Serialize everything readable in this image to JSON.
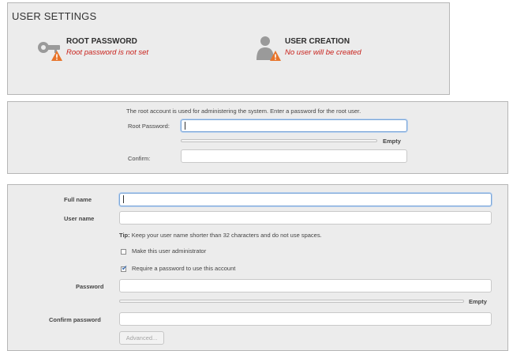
{
  "user_settings": {
    "title": "USER SETTINGS",
    "spokes": [
      {
        "title": "ROOT PASSWORD",
        "status": "Root password is not set",
        "icon": "key-warning-icon"
      },
      {
        "title": "USER CREATION",
        "status": "No user will be created",
        "icon": "user-warning-icon"
      }
    ]
  },
  "root_password": {
    "intro": "The root account is used for administering the system.  Enter a password for the root user.",
    "password_label": "Root Password:",
    "password_value": "",
    "strength_value": 0,
    "strength_label": "Empty",
    "confirm_label": "Confirm:",
    "confirm_value": ""
  },
  "user_creation": {
    "full_name_label": "Full name",
    "full_name_value": "",
    "user_name_label": "User name",
    "user_name_value": "",
    "tip_prefix": "Tip:",
    "tip_text": " Keep your user name shorter than 32 characters and do not use spaces.",
    "admin_label": "Make this user administrator",
    "admin_checked": false,
    "require_password_label": "Require a password to use this account",
    "require_password_checked": true,
    "password_label": "Password",
    "password_value": "",
    "strength_value": 0,
    "strength_label": "Empty",
    "confirm_label": "Confirm password",
    "confirm_value": "",
    "advanced_label": "Advanced..."
  },
  "colors": {
    "warning_red": "#c8211b",
    "warning_orange": "#e8742a",
    "focus_blue": "#7ca6d8"
  }
}
